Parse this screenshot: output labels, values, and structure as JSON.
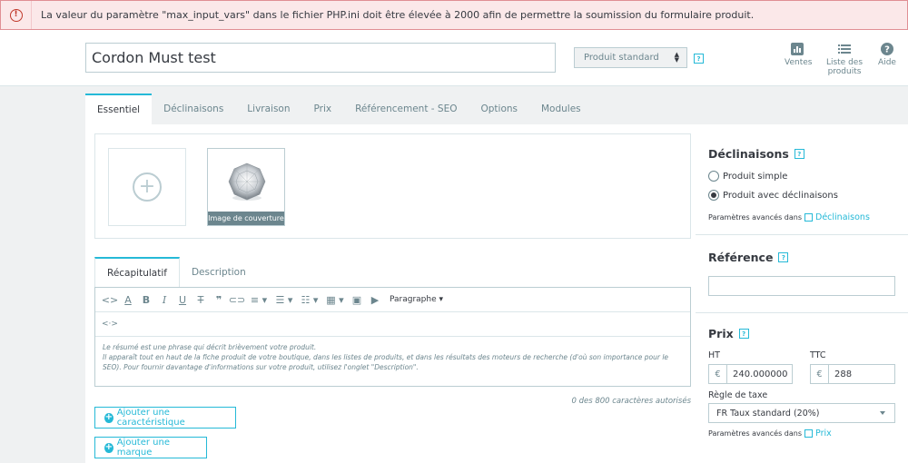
{
  "alert": {
    "message": "La valeur du paramètre \"max_input_vars\" dans le fichier PHP.ini doit être élevée à 2000 afin de permettre la soumission du formulaire produit."
  },
  "header": {
    "product_name": "Cordon Must test",
    "product_type": "Produit standard",
    "toolbar": {
      "ventes": "Ventes",
      "liste": "Liste des produits",
      "aide": "Aide"
    }
  },
  "tabs": [
    "Essentiel",
    "Déclinaisons",
    "Livraison",
    "Prix",
    "Référencement - SEO",
    "Options",
    "Modules"
  ],
  "images": {
    "cover_label": "Image de couverture"
  },
  "description": {
    "tabs": [
      "Récapitulatif",
      "Description"
    ],
    "paragraph_format": "Paragraphe",
    "content_lines": [
      "Le résumé est une phrase qui décrit brièvement votre produit.",
      "Il apparaît tout en haut de la fiche produit de votre boutique, dans les listes de produits, et dans les résultats des moteurs de recherche (d'où son importance pour le SEO). Pour fournir davantage d'informations sur votre produit, utilisez l'onglet \"Description\"."
    ],
    "char_count": "0 des 800 caractères autorisés"
  },
  "buttons": {
    "add_feature": "Ajouter une caractéristique",
    "add_brand": "Ajouter une marque"
  },
  "declinaisons": {
    "title": "Déclinaisons",
    "option_simple": "Produit simple",
    "option_combinations": "Produit avec déclinaisons",
    "selected": "Produit avec déclinaisons",
    "advanced_prefix": "Paramètres avancés dans",
    "advanced_link": "Déclinaisons"
  },
  "reference": {
    "title": "Référence",
    "value": ""
  },
  "prix": {
    "title": "Prix",
    "ht_label": "HT",
    "ttc_label": "TTC",
    "currency": "€",
    "ht_value": "240.000000",
    "ttc_value": "288",
    "tax_label": "Règle de taxe",
    "tax_value": "FR Taux standard (20%)",
    "advanced_prefix": "Paramètres avancés dans",
    "advanced_link": "Prix"
  },
  "colors": {
    "accent": "#25b9d7",
    "error_bg": "#fbe8e9",
    "error_border": "#e08f95"
  }
}
